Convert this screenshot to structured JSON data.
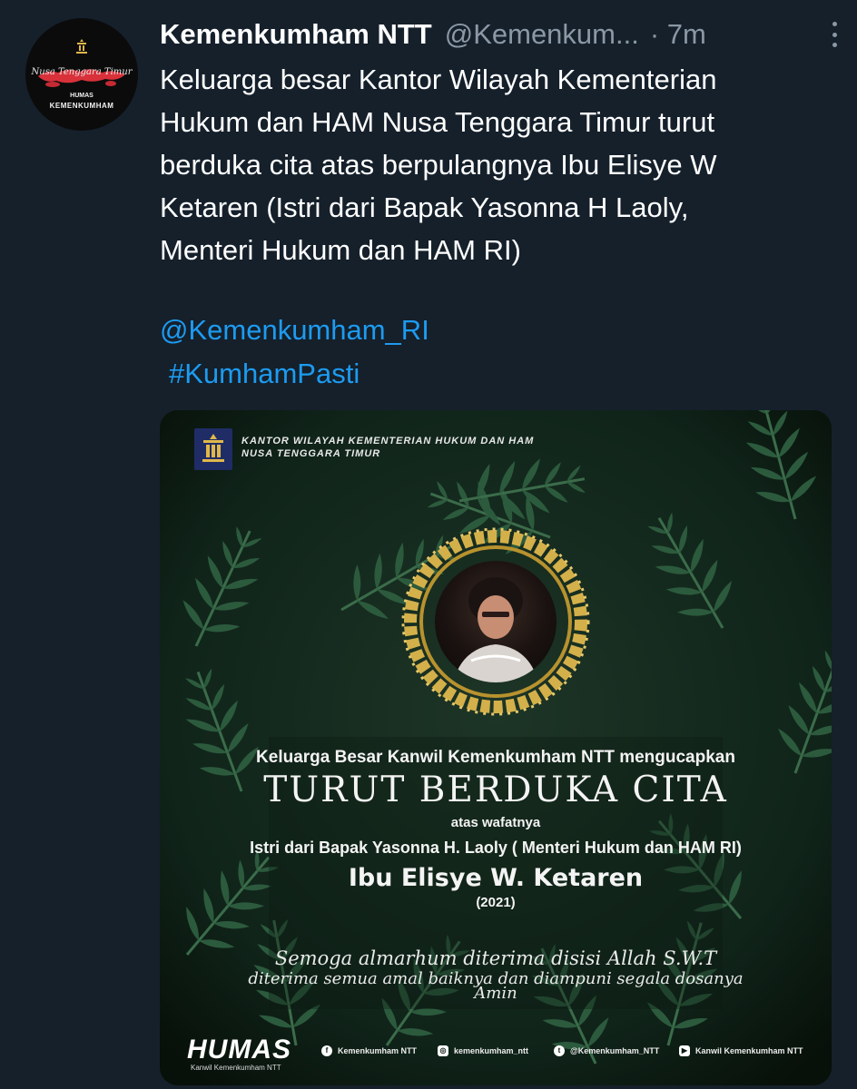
{
  "account": {
    "display_name": "Kemenkumham NTT",
    "handle": "@Kemenkum...",
    "time": "· 7m",
    "avatar": {
      "script": "Nusa Tenggara Timur",
      "label_top": "HUMAS",
      "label_bottom": "KEMENKUMHAM"
    }
  },
  "tweet": {
    "lines": [
      "Keluarga besar Kantor Wilayah Kementerian",
      "Hukum dan HAM Nusa Tenggara Timur turut",
      "berduka cita atas berpulangnya Ibu Elisye W",
      "Ketaren (Istri dari Bapak Yasonna H Laoly,",
      "Menteri Hukum dan HAM RI)"
    ],
    "mention": "@Kemenkumham_RI",
    "hashtag": "#KumhamPasti"
  },
  "media": {
    "office_line1": "KANTOR WILAYAH KEMENTERIAN HUKUM DAN HAM",
    "office_line2": "NUSA TENGGARA TIMUR",
    "line1": "Keluarga Besar Kanwil Kemenkumham NTT mengucapkan",
    "line2": "TURUT BERDUKA CITA",
    "line3": "atas wafatnya",
    "line4": "Istri dari Bapak Yasonna H. Laoly ( Menteri Hukum dan HAM RI)",
    "line5": "Ibu Elisye W. Ketaren",
    "line6": "(2021)",
    "prayer1": "Semoga almarhum diterima disisi Allah S.W.T",
    "prayer2": "diterima semua amal baiknya dan diampuni segala dosanya",
    "prayer3": "Amin",
    "footer": {
      "humas": "HUMAS",
      "humas_sub": "Kanwil Kemenkumham NTT",
      "facebook": "Kemenkumham NTT",
      "instagram": "kemenkumham_ntt",
      "twitter": "@Kemenkumham_NTT",
      "youtube": "Kanwil Kemenkumham NTT"
    }
  },
  "colors": {
    "background": "#15202b",
    "link": "#1d9bf0",
    "secondary_text": "#8b98a5",
    "frame_gold": "#d4b04a"
  }
}
